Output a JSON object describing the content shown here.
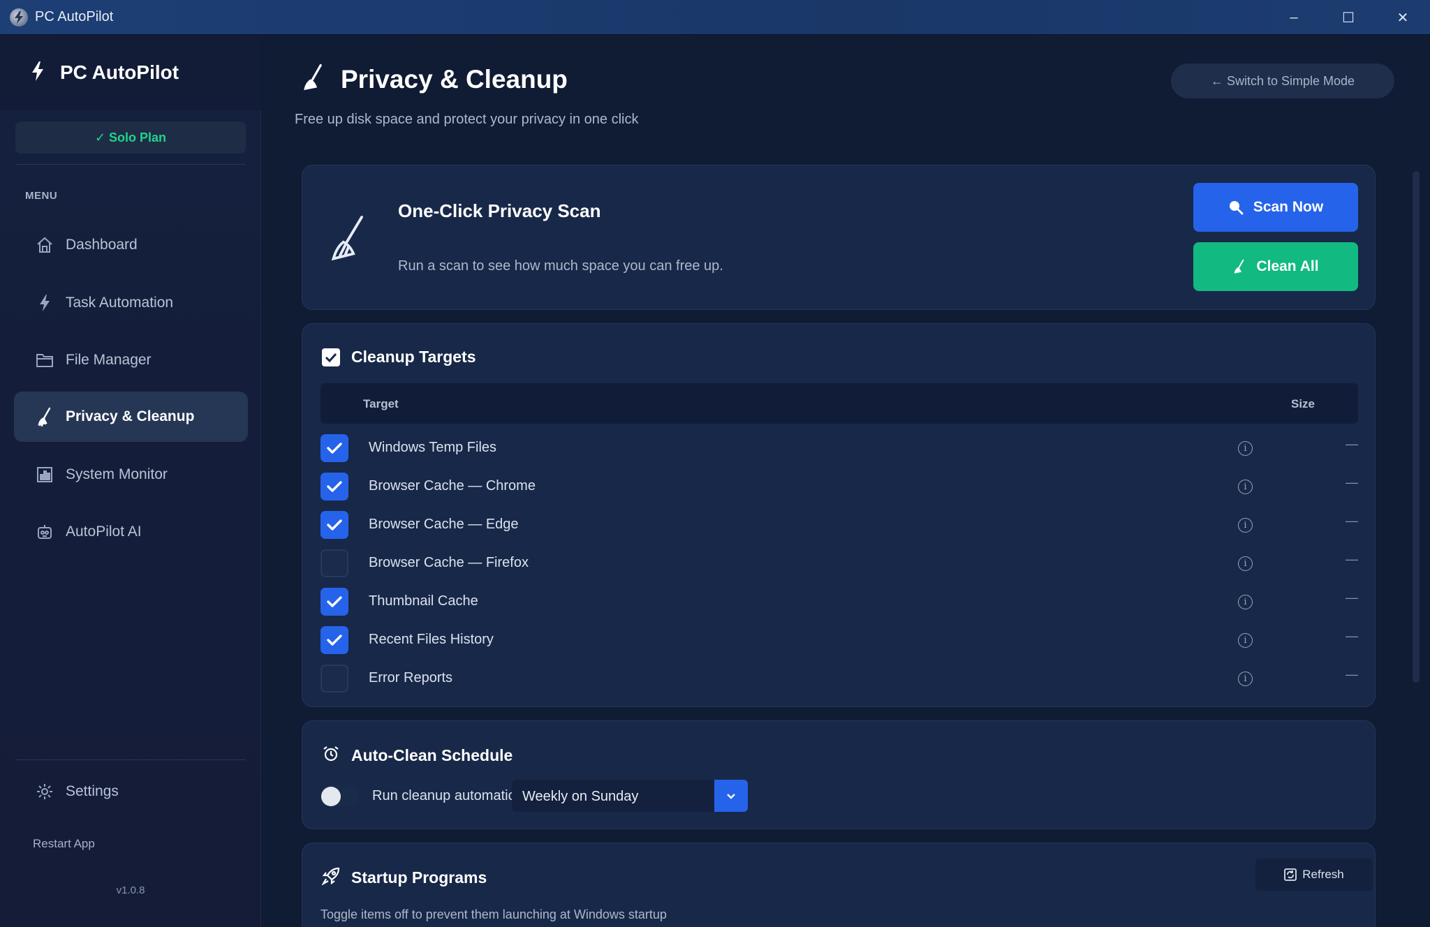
{
  "window": {
    "title": "PC AutoPilot",
    "minimize": "–",
    "maximize": "☐",
    "close": "✕"
  },
  "sidebar": {
    "brand": "PC AutoPilot",
    "plan": "✓ Solo Plan",
    "menu_label": "MENU",
    "items": [
      {
        "label": "Dashboard",
        "icon": "home-icon"
      },
      {
        "label": "Task Automation",
        "icon": "lightning-icon"
      },
      {
        "label": "File Manager",
        "icon": "folder-icon"
      },
      {
        "label": "Privacy & Cleanup",
        "icon": "broom-icon",
        "active": true
      },
      {
        "label": "System Monitor",
        "icon": "chart-icon"
      },
      {
        "label": "AutoPilot AI",
        "icon": "robot-icon"
      }
    ],
    "settings": "Settings",
    "restart": "Restart App",
    "version": "v1.0.8"
  },
  "header": {
    "title": "Privacy & Cleanup",
    "subtitle": "Free up disk space and protect your privacy in one click",
    "simple_mode": "← Switch to Simple Mode"
  },
  "scan": {
    "title": "One-Click Privacy Scan",
    "description": "Run a scan to see how much space you can free up.",
    "scan_button": "Scan Now",
    "clean_button": "Clean All"
  },
  "targets": {
    "title": "Cleanup Targets",
    "col_target": "Target",
    "col_size": "Size",
    "info_glyph": "i",
    "rows": [
      {
        "label": "Windows Temp Files",
        "checked": true,
        "size": "—"
      },
      {
        "label": "Browser Cache — Chrome",
        "checked": true,
        "size": "—"
      },
      {
        "label": "Browser Cache — Edge",
        "checked": true,
        "size": "—"
      },
      {
        "label": "Browser Cache — Firefox",
        "checked": false,
        "size": "—"
      },
      {
        "label": "Thumbnail Cache",
        "checked": true,
        "size": "—"
      },
      {
        "label": "Recent Files History",
        "checked": true,
        "size": "—"
      },
      {
        "label": "Error Reports",
        "checked": false,
        "size": "—"
      }
    ]
  },
  "schedule": {
    "title": "Auto-Clean Schedule",
    "toggle_label": "Run cleanup automatically",
    "toggle_on": false,
    "frequency": "Weekly on Sunday"
  },
  "startup": {
    "title": "Startup Programs",
    "refresh": "Refresh",
    "description": "Toggle items off to prevent them launching at Windows startup"
  },
  "colors": {
    "accent_blue": "#2563eb",
    "accent_green": "#12b981",
    "plan_green": "#22d38a"
  }
}
